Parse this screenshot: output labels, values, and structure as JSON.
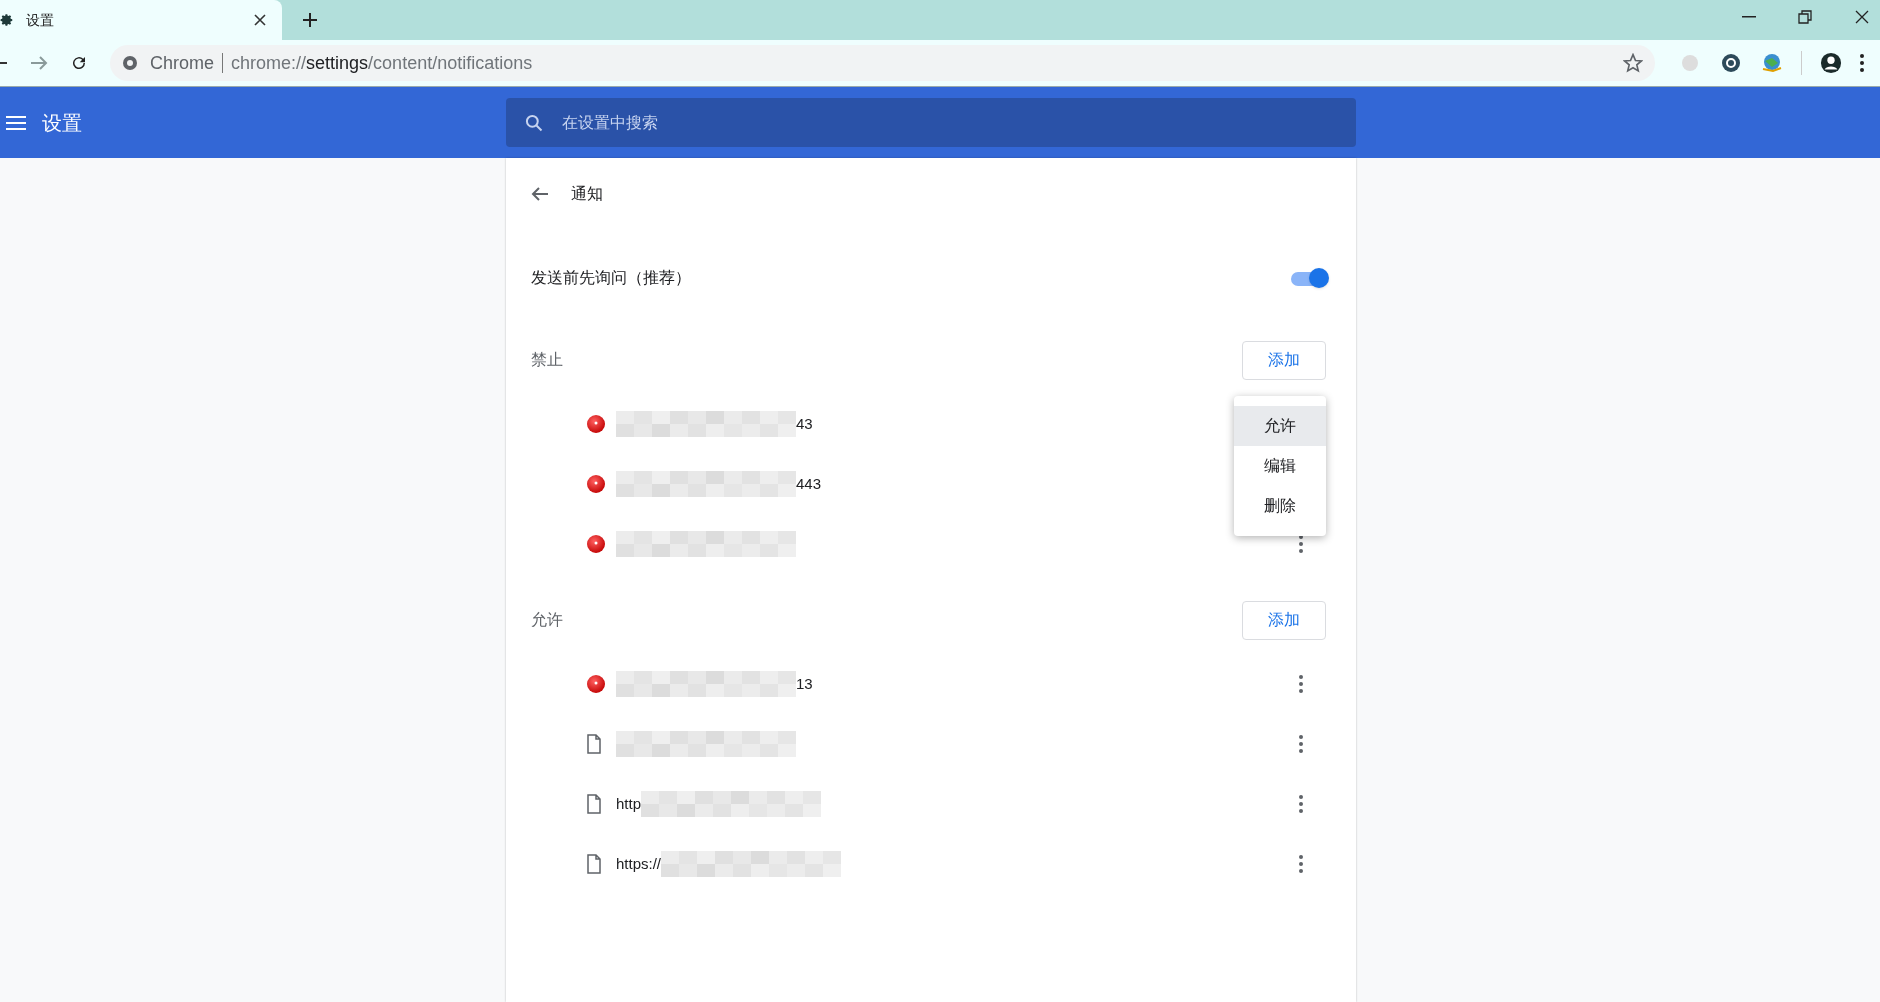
{
  "browser": {
    "tab": {
      "title": "设置"
    },
    "address": {
      "origin_label": "Chrome",
      "url_start": "chrome://",
      "url_host": "settings",
      "url_path": "/content/notifications"
    }
  },
  "header": {
    "title": "设置",
    "search": {
      "placeholder": "在设置中搜索"
    }
  },
  "page": {
    "title": "通知",
    "ask_before_sending": {
      "label": "发送前先询问（推荐）",
      "on": true
    },
    "sections": [
      {
        "title": "禁止",
        "add_button": "添加",
        "sites": [
          {
            "kind": "favicon",
            "shown_end": "43",
            "more_button": false
          },
          {
            "kind": "favicon",
            "shown_end": "443",
            "more_button": false
          },
          {
            "kind": "favicon",
            "more_button": true
          }
        ]
      },
      {
        "title": "允许",
        "add_button": "添加",
        "sites": [
          {
            "kind": "favicon",
            "shown_end": "13",
            "more_button": true
          },
          {
            "kind": "page",
            "more_button": true
          },
          {
            "kind": "page",
            "shown_start": "http",
            "more_button": true
          },
          {
            "kind": "page",
            "shown_start": "https://",
            "more_button": true
          }
        ]
      }
    ]
  },
  "context_menu": {
    "items": [
      {
        "label": "允许",
        "selected": true
      },
      {
        "label": "编辑",
        "selected": false
      },
      {
        "label": "删除",
        "selected": false
      }
    ]
  }
}
